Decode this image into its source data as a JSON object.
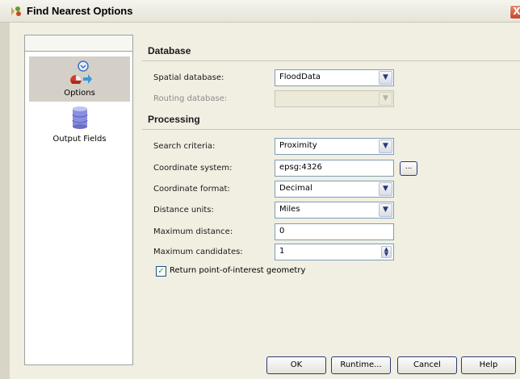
{
  "window": {
    "title": "Find Nearest Options",
    "close_glyph": "X"
  },
  "sidebar": {
    "items": [
      {
        "label": "Options",
        "icon": "options-icon",
        "selected": true
      },
      {
        "label": "Output Fields",
        "icon": "database-icon",
        "selected": false
      }
    ]
  },
  "database_section": {
    "title": "Database",
    "spatial_label": "Spatial database:",
    "spatial_value": "FloodData",
    "routing_label": "Routing database:",
    "routing_value": ""
  },
  "processing_section": {
    "title": "Processing",
    "search_label": "Search criteria:",
    "search_value": "Proximity",
    "coord_system_label": "Coordinate system:",
    "coord_system_value": "epsg:4326",
    "browse_label": "...",
    "coord_format_label": "Coordinate format:",
    "coord_format_value": "Decimal",
    "distance_units_label": "Distance units:",
    "distance_units_value": "Miles",
    "max_distance_label": "Maximum distance:",
    "max_distance_value": "0",
    "max_candidates_label": "Maximum candidates:",
    "max_candidates_value": "1",
    "poi_checkbox_label": "Return point-of-interest geometry",
    "poi_checked": true
  },
  "buttons": {
    "ok": "OK",
    "runtime": "Runtime...",
    "cancel": "Cancel",
    "help": "Help"
  },
  "colors": {
    "accent_border": "#2a3a74",
    "frame": "#f1efe2",
    "check": "#21a121"
  }
}
